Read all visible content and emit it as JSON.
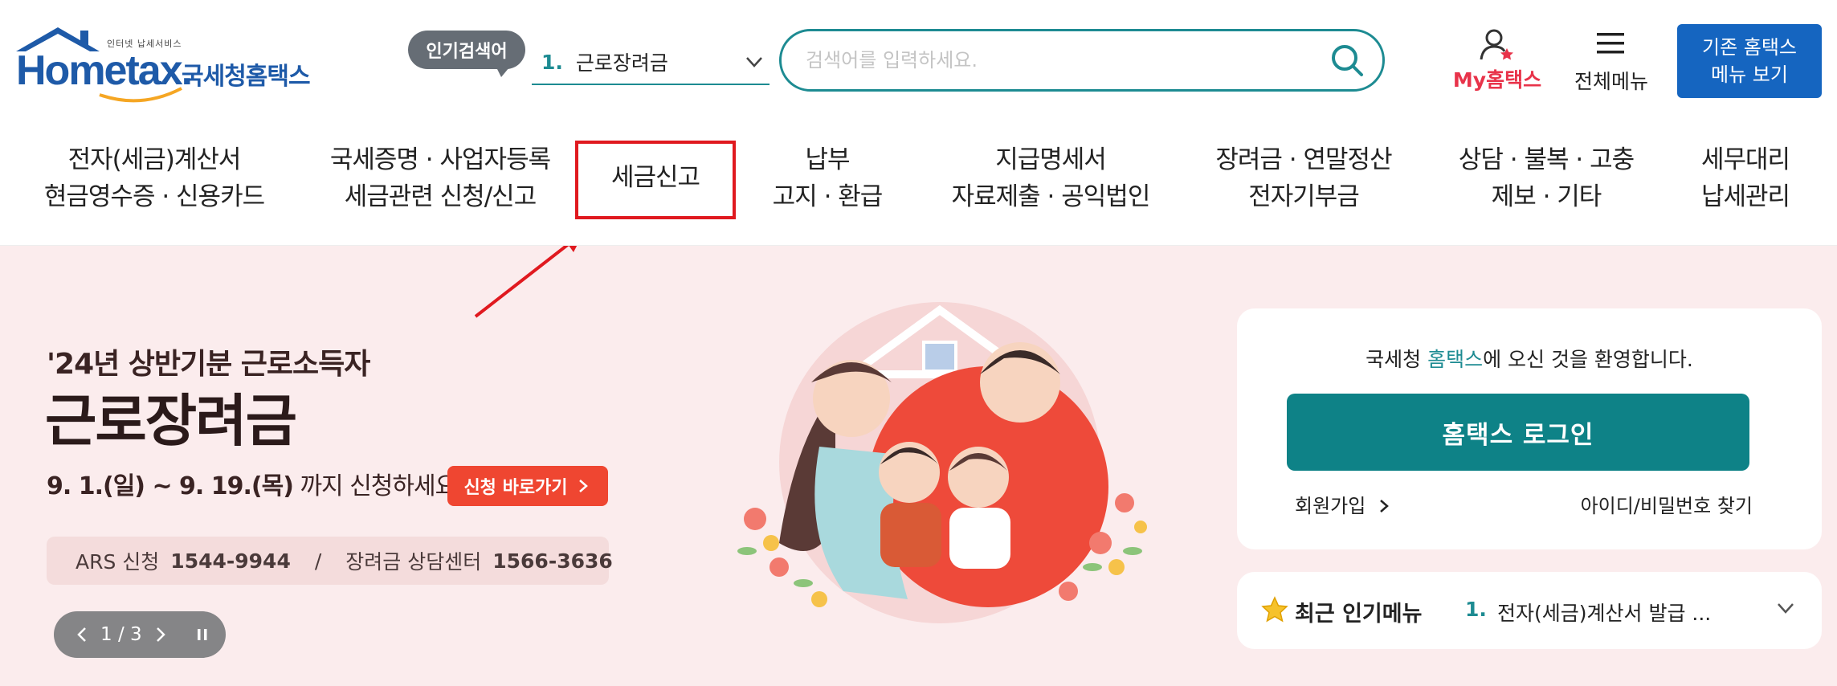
{
  "header": {
    "logo": {
      "caption": "인터넷 납세서비스",
      "word": "Hometax.",
      "name_ko": "국세청홈택스"
    },
    "popular_search": {
      "badge": "인기검색어",
      "rank": "1.",
      "keyword": "근로장려금"
    },
    "search": {
      "placeholder": "검색어를 입력하세요."
    },
    "my_hometax": "My홈택스",
    "full_menu": "전체메뉴",
    "classic_view": [
      "기존 홈택스",
      "메뉴 보기"
    ]
  },
  "gnb": [
    [
      "전자(세금)계산서",
      "현금영수증 · 신용카드"
    ],
    [
      "국세증명 · 사업자등록",
      "세금관련 신청/신고"
    ],
    [
      "세금신고"
    ],
    [
      "납부",
      "고지 · 환급"
    ],
    [
      "지급명세서",
      "자료제출 · 공익법인"
    ],
    [
      "장려금 · 연말정산",
      "전자기부금"
    ],
    [
      "상담 · 불복 · 고충",
      "제보 · 기타"
    ],
    [
      "세무대리",
      "납세관리"
    ]
  ],
  "banner": {
    "subtitle": "'24년 상반기분 근로소득자",
    "title": "근로장려금",
    "period": "9. 1.(일) ~ 9. 19.(목)",
    "period_suffix": " 까지 신청하세요!",
    "apply_button": "신청 바로가기",
    "ars_label": "ARS 신청",
    "ars_number": "1544-9944",
    "separator": "/",
    "center_label": "장려금 상담센터",
    "center_number": "1566-3636",
    "pager": "1 / 3"
  },
  "login": {
    "welcome_prefix": "국세청 ",
    "welcome_brand": "홈택스",
    "welcome_suffix": "에 오신 것을 환영합니다.",
    "login_button": "홈택스 로그인",
    "signup": "회원가입",
    "find_id": "아이디/비밀번호 찾기"
  },
  "popular_menu": {
    "title": "최근 인기메뉴",
    "rank": "1.",
    "item": "전자(세금)계산서 발급 ..."
  },
  "colors": {
    "teal": "#1d8b92",
    "brand_blue": "#1565c0",
    "highlight_red": "#e0191f",
    "banner_bg": "#fbeced",
    "apply_red": "#ef4631"
  }
}
